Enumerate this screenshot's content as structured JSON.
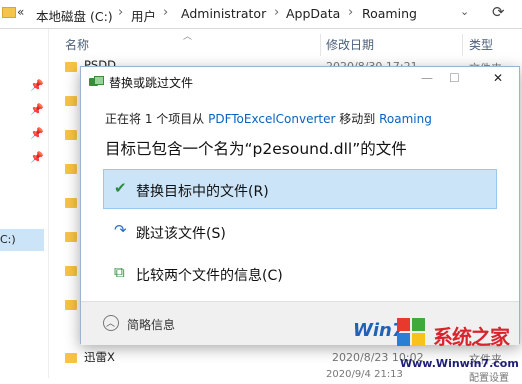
{
  "address_bar": {
    "chevron": "«",
    "crumbs": [
      "本地磁盘 (C:)",
      "用户",
      "Administrator",
      "AppData",
      "Roaming"
    ],
    "separator": "›"
  },
  "sidebar": {
    "drive_label": "C:)"
  },
  "columns": {
    "name": "名称",
    "modified": "修改日期",
    "type": "类型"
  },
  "background_rows": [
    {
      "name": "PSDD",
      "date": "2020/8/30 17:21",
      "type": "文件夹"
    },
    {
      "name": "迅雷X",
      "date": "2020/8/23 10:02",
      "type": "文件夹"
    }
  ],
  "bottom_row": {
    "date": "2020/9/4 21:13",
    "type": "配置设置"
  },
  "dialog": {
    "title": "替换或跳过文件",
    "minimize": "—",
    "maximize": "☐",
    "close": "✕",
    "status": {
      "prefix": "正在将 1 个项目从",
      "source": "PDFToExcelConverter",
      "middle": "移动到",
      "dest": "Roaming"
    },
    "headline": "目标已包含一个名为“p2esound.dll”的文件",
    "options": [
      {
        "icon": "✔",
        "label": "替换目标中的文件(R)"
      },
      {
        "icon": "↷",
        "label": "跳过该文件(S)"
      },
      {
        "icon": "⧉",
        "label": "比较两个文件的信息(C)"
      }
    ],
    "details_label": "简略信息",
    "details_icon": "︿"
  },
  "watermark": {
    "win_text": "Win7",
    "name": "系统之家",
    "url": "Www.Winwin7.com"
  }
}
